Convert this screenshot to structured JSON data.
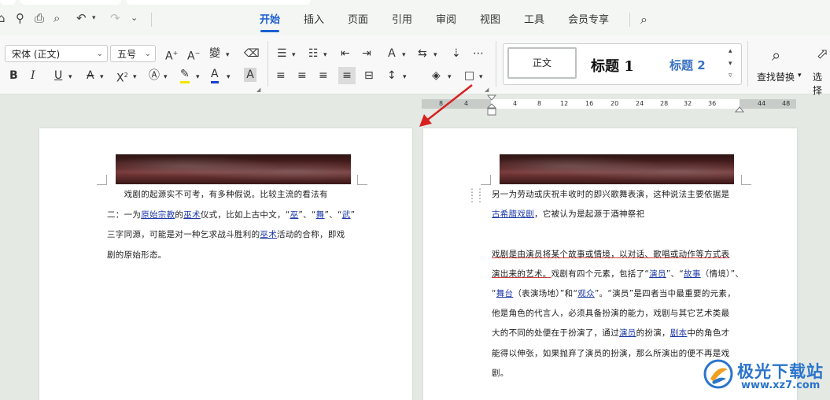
{
  "menu": {
    "tabs": [
      "开始",
      "插入",
      "页面",
      "引用",
      "审阅",
      "视图",
      "工具",
      "会员专享"
    ]
  },
  "ribbon": {
    "font_name": "宋体 (正文)",
    "font_size": "五号",
    "styles": {
      "normal": "正文",
      "h1": "标题 1",
      "h2": "标题 2"
    },
    "find_replace": "查找替换",
    "select": "选择"
  },
  "ruler": {
    "ticks": [
      "8",
      "4",
      "4",
      "8",
      "12",
      "16",
      "20",
      "24",
      "28",
      "32",
      "36",
      "44",
      "48"
    ]
  },
  "doc": {
    "left_page": {
      "lines": [
        [
          {
            "t": "　　戏剧的起源实不可考，有多种假说。比较主流的看法有"
          }
        ],
        [
          {
            "t": "二：一为"
          },
          {
            "t": "原始宗教",
            "link": true
          },
          {
            "t": "的"
          },
          {
            "t": "巫术",
            "link": true
          },
          {
            "t": "仪式，比如上古中文，“"
          },
          {
            "t": "巫",
            "link": true
          },
          {
            "t": "”、“"
          },
          {
            "t": "舞",
            "link": true
          },
          {
            "t": "”、“"
          },
          {
            "t": "武",
            "link": true
          },
          {
            "t": "”"
          }
        ],
        [
          {
            "t": "三字同源，可能是对一种乞求战斗胜利的"
          },
          {
            "t": "巫术",
            "link": true
          },
          {
            "t": "活动的合称，即戏"
          }
        ],
        [
          {
            "t": "剧的原始形态。"
          }
        ]
      ]
    },
    "right_page": {
      "lines": [
        [
          {
            "t": "另一为劳动或庆祝丰收时的即兴歌舞表演，这种说法主要依据是"
          }
        ],
        [
          {
            "t": "古希腊戏剧",
            "link": true
          },
          {
            "t": "，它被认为是起源于酒神祭祀"
          }
        ],
        [
          {
            "t": ""
          }
        ],
        [
          {
            "t": "戏剧是由演员将某个故事或情境，以对话、歌唱或动作等方式表",
            "red": true
          }
        ],
        [
          {
            "t": "演出来的艺术。",
            "red": true
          },
          {
            "t": "戏剧有四个元素，包括了“"
          },
          {
            "t": "演员",
            "link": true
          },
          {
            "t": "”、“"
          },
          {
            "t": "故事",
            "link": true
          },
          {
            "t": "（情境）”、"
          }
        ],
        [
          {
            "t": "“"
          },
          {
            "t": "舞台",
            "link": true
          },
          {
            "t": "（表演场地）”和“"
          },
          {
            "t": "观众",
            "link": true
          },
          {
            "t": "”。“演员”是四者当中最重要的元素，"
          }
        ],
        [
          {
            "t": "他是角色的代言人，必须具备扮演的能力，戏剧与其它艺术类最"
          }
        ],
        [
          {
            "t": "大的不同的处便在于扮演了，通过"
          },
          {
            "t": "演员",
            "link": true
          },
          {
            "t": "的扮演，"
          },
          {
            "t": "剧本",
            "link": true
          },
          {
            "t": "中的角色才"
          }
        ],
        [
          {
            "t": "能得以伸张，如果抛弃了演员的扮演，那么所演出的便不再是戏"
          }
        ],
        [
          {
            "t": "剧。"
          }
        ]
      ]
    }
  },
  "watermark": {
    "name": "极光下载站",
    "url": "www.xz7.com"
  }
}
